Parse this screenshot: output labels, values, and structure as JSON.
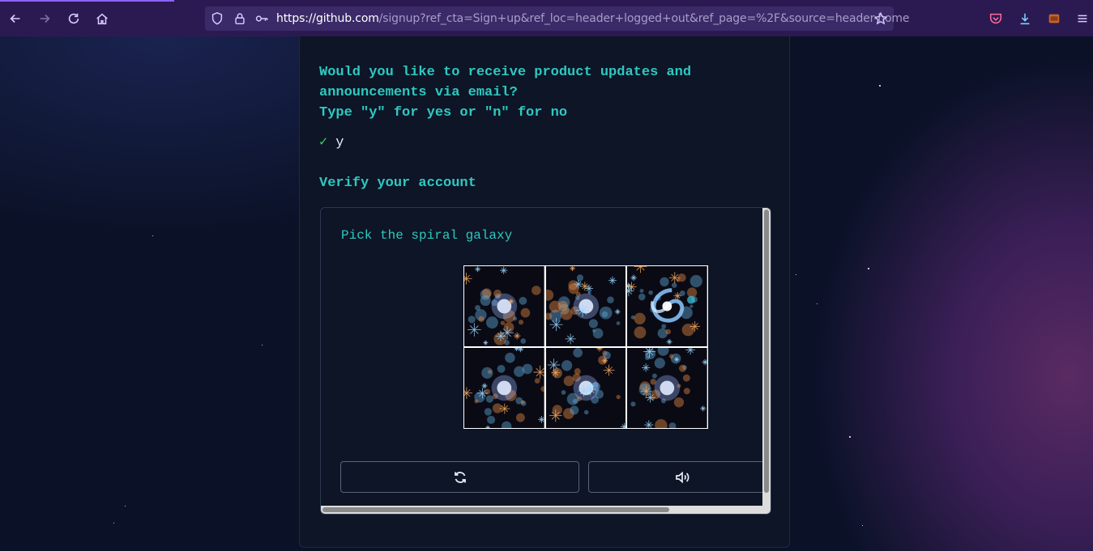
{
  "browser": {
    "url_host": "https://github.com",
    "url_path": "/signup?ref_cta=Sign+up&ref_loc=header+logged+out&ref_page=%2F&source=header-home",
    "icons": [
      "back-arrow-icon",
      "forward-arrow-icon",
      "reload-icon",
      "home-icon",
      "shield-icon",
      "lock-icon",
      "key-icon",
      "star-icon",
      "pocket-icon",
      "download-icon",
      "extension-icon",
      "menu-icon"
    ]
  },
  "signup": {
    "question_line1": "Would you like to receive product updates and",
    "question_line2": "announcements via email?",
    "question_line3": "Type \"y\" for yes or \"n\" for no",
    "answer_check": "✓",
    "answer": "y",
    "verify_heading": "Verify your account"
  },
  "captcha": {
    "prompt": "Pick the spiral galaxy",
    "tiles": [
      {
        "name": "captcha-tile-1",
        "kind": "elliptical"
      },
      {
        "name": "captcha-tile-2",
        "kind": "elliptical"
      },
      {
        "name": "captcha-tile-3",
        "kind": "spiral"
      },
      {
        "name": "captcha-tile-4",
        "kind": "elliptical"
      },
      {
        "name": "captcha-tile-5",
        "kind": "elliptical"
      },
      {
        "name": "captcha-tile-6",
        "kind": "elliptical"
      }
    ],
    "buttons": [
      {
        "name": "reload-challenge-button",
        "icon": "refresh-icon"
      },
      {
        "name": "audio-challenge-button",
        "icon": "speaker-icon"
      }
    ]
  },
  "colors": {
    "accent": "#2ec9c0",
    "check": "#35d05b",
    "toolbar": "#2b1a52"
  }
}
